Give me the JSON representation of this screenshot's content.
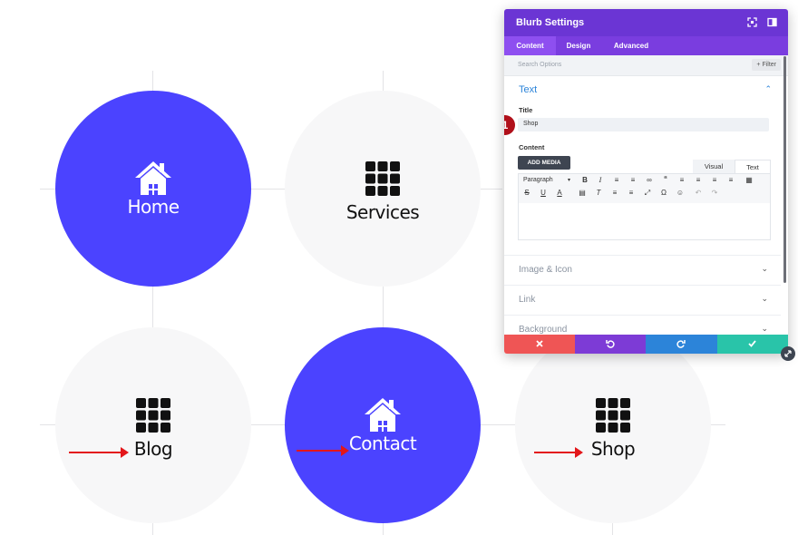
{
  "blurbs": [
    {
      "label": "Home",
      "icon": "home-icon",
      "style": "blue"
    },
    {
      "label": "Services",
      "icon": "grid-icon",
      "style": "light"
    },
    {
      "label": "Blog",
      "icon": "grid-icon",
      "style": "light"
    },
    {
      "label": "Contact",
      "icon": "home-icon",
      "style": "blue"
    },
    {
      "label": "Shop",
      "icon": "grid-icon",
      "style": "light"
    }
  ],
  "colors": {
    "accent": "#4b43ff",
    "panel_header": "#6b35d4",
    "arrow": "#e3161a"
  },
  "panel": {
    "title": "Blurb Settings",
    "tabs": [
      "Content",
      "Design",
      "Advanced"
    ],
    "active_tab": "Content",
    "search_placeholder": "Search Options",
    "filter_label": "+ Filter",
    "section_title": "Text",
    "title_label": "Title",
    "title_value": "Shop",
    "step_badge": "1",
    "content_label": "Content",
    "add_media": "ADD MEDIA",
    "editor_tabs": [
      "Visual",
      "Text"
    ],
    "paragraph_select": "Paragraph",
    "collapsed_sections": [
      "Image & Icon",
      "Link",
      "Background"
    ],
    "actions": [
      {
        "name": "cancel",
        "color": "#ef5555"
      },
      {
        "name": "undo",
        "color": "#7d3bd6"
      },
      {
        "name": "redo",
        "color": "#2c84d9"
      },
      {
        "name": "save",
        "color": "#29c4a9"
      }
    ]
  }
}
